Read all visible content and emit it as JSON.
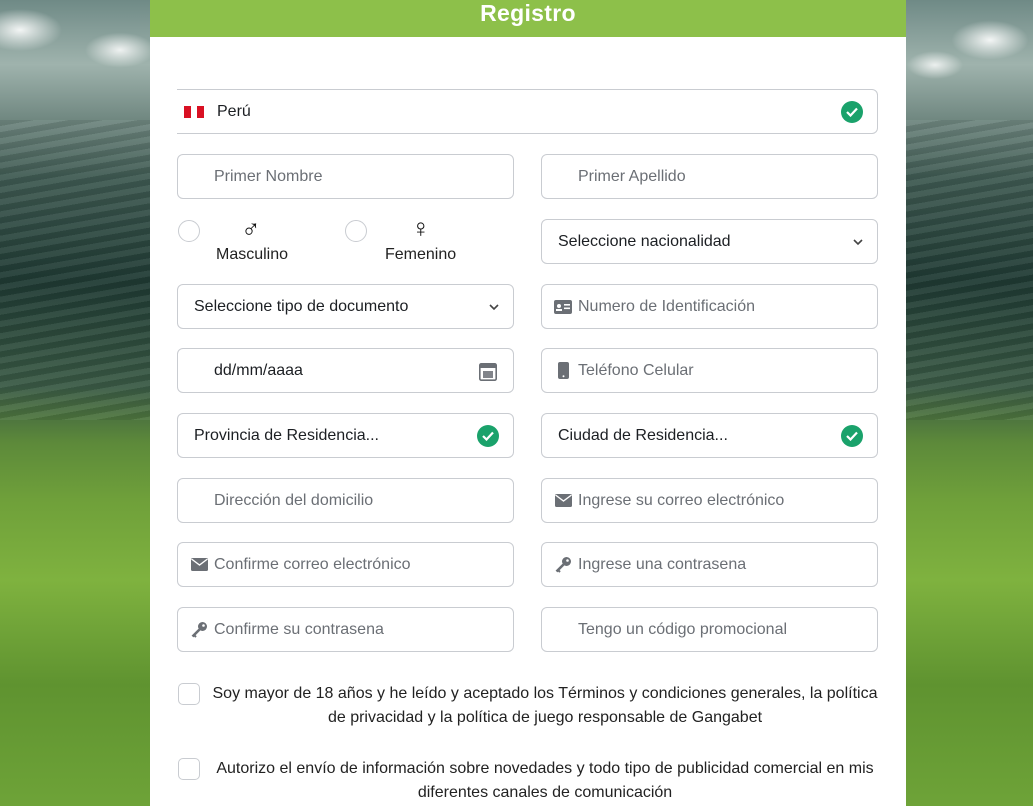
{
  "header": {
    "title": "Registro"
  },
  "country": {
    "value": "Perú"
  },
  "fields": {
    "first_name": "Primer Nombre",
    "last_name": "Primer Apellido",
    "nationality": "Seleccione nacionalidad",
    "document_type": "Seleccione tipo de documento",
    "id_number": "Numero de Identificación",
    "birthdate": "dd/mm/aaaa",
    "phone": "Teléfono Celular",
    "province": "Provincia de Residencia...",
    "city": "Ciudad de Residencia...",
    "address": "Dirección del domicilio",
    "email": "Ingrese su correo electrónico",
    "confirm_email": "Confirme correo electrónico",
    "password": "Ingrese una contrasena",
    "confirm_password": "Confirme su contrasena",
    "promo_code": "Tengo un código promocional"
  },
  "gender": {
    "male_symbol": "♂",
    "male_label": "Masculino",
    "female_symbol": "♀",
    "female_label": "Femenino"
  },
  "consents": {
    "terms_line1": "Soy mayor de 18 años y he leído y aceptado los Términos y condiciones generales, la política",
    "terms_line2": "de privacidad y la política de juego responsable de Gangabet",
    "marketing_line1": "Autorizo el envío de información sobre novedades y todo tipo de publicidad comercial en mis",
    "marketing_line2": "diferentes canales de comunicación"
  },
  "colors": {
    "header_bg": "#8dc04a",
    "valid_check": "#1aa26b",
    "border": "#c9ccd1"
  },
  "icons": {
    "flag": "peru-flag-icon",
    "valid": "check-circle-icon",
    "dropdown": "chevron-down-icon",
    "id": "id-card-icon",
    "calendar": "calendar-icon",
    "phone": "mobile-phone-icon",
    "email": "envelope-icon",
    "password": "key-icon"
  }
}
